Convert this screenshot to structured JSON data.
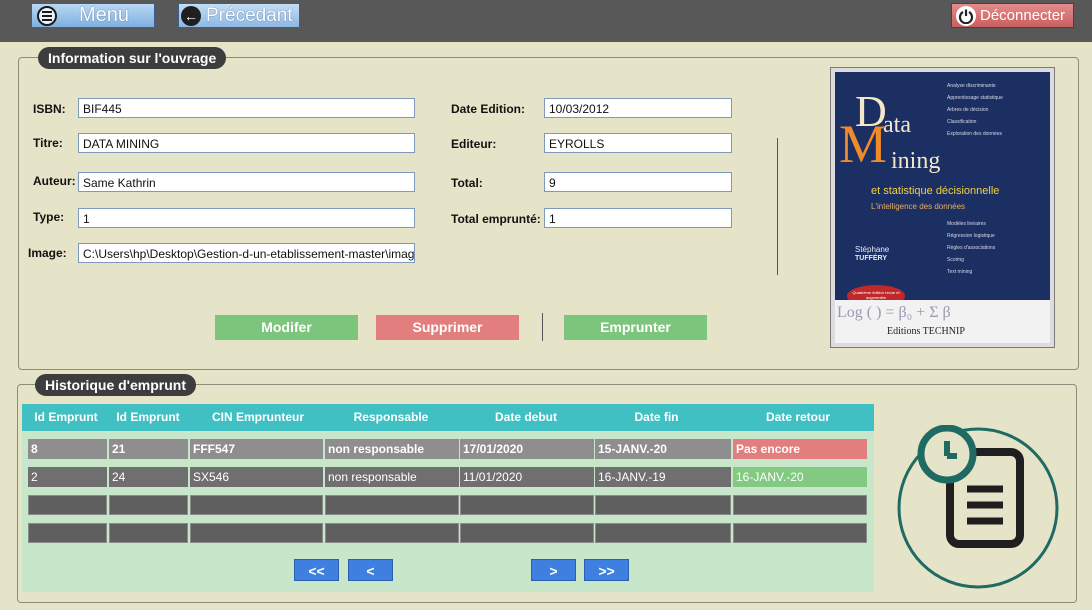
{
  "topbar": {
    "menu_label": "Menu",
    "prev_label": "Précedant",
    "logout_label": "Déconnecter",
    "icons": {
      "menu": "hamburger-icon",
      "prev": "arrow-left-circle-icon",
      "logout": "power-icon"
    }
  },
  "book": {
    "section_title": "Information sur l'ouvrage",
    "labels": {
      "isbn": "ISBN:",
      "titre": "Titre:",
      "auteur": "Auteur:",
      "type": "Type:",
      "image": "Image:",
      "date_edition": "Date Edition:",
      "editeur": "Editeur:",
      "total": "Total:",
      "total_emprunte": "Total emprunté:"
    },
    "values": {
      "isbn": "BIF445",
      "titre": "DATA MINING",
      "auteur": "Same Kathrin",
      "type": "1",
      "image": "C:\\Users\\hp\\Desktop\\Gestion-d-un-etablissement-master\\image",
      "date_edition": "10/03/2012",
      "editeur": "EYROLLS",
      "total": "9",
      "total_emprunte": "1"
    },
    "actions": {
      "modify": "Modifer",
      "delete": "Supprimer",
      "borrow": "Emprunter"
    },
    "colors": {
      "green": "#7dc47d",
      "red": "#e27e7e"
    }
  },
  "cover": {
    "title_d": "D",
    "title_ata": "ata",
    "title_m": "M",
    "title_ining": "ining",
    "subtitle": "et statistique décisionnelle",
    "tagline": "L'intelligence des données",
    "author_first": "Stéphane",
    "author_last": "TUFFÉRY",
    "publisher": "Editions TECHNIP",
    "badge": "Quatrième édition revue et augmentée",
    "topics_top": [
      "Analyse discriminante",
      "Apprentissage statistique",
      "Arbres de décision",
      "Classification",
      "Exploration des données"
    ],
    "topics_bottom": [
      "Modèles linéaires",
      "Régression logistique",
      "Règles d'associations",
      "Scoring",
      "Text mining"
    ]
  },
  "history": {
    "section_title": "Historique d'emprunt",
    "columns": [
      "Id Emprunt",
      "Id Emprunt",
      "CIN Emprunteur",
      "Responsable",
      "Date debut",
      "Date fin",
      "Date retour"
    ],
    "rows": [
      [
        "8",
        "21",
        "FFF547",
        "non responsable",
        "17/01/2020",
        "15-JANV.-20",
        "Pas encore"
      ],
      [
        "2",
        "24",
        "SX546",
        "non responsable",
        "11/01/2020",
        "16-JANV.-19",
        "16-JANV.-20"
      ]
    ],
    "pager": {
      "first": "<<",
      "prev": "<",
      "next": ">",
      "last": ">>"
    },
    "colors": {
      "header": "#41c0c4",
      "late": "#e27e7e",
      "returned": "#82c982"
    }
  },
  "icons": {
    "history": "document-clock-icon"
  }
}
